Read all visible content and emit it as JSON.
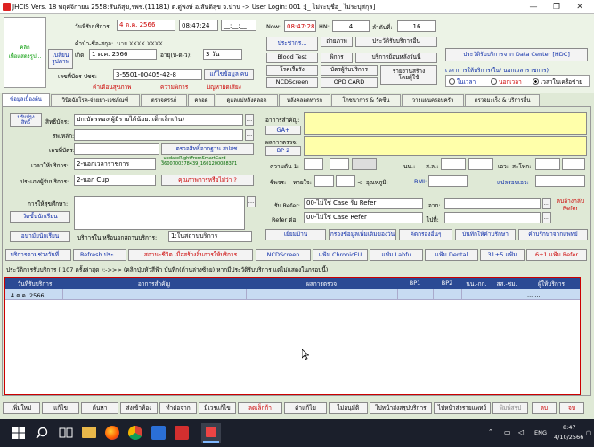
{
  "window": {
    "title": "JHCIS Vers. 18 พฤศจิกายน 2558:สันติสุข,รพช.(11181) ต.ดู่พงษ์ อ.สันติสุข จ.น่าน -> User Login: 001 :[_ ไม่ระบุชื่อ_ ไม่ระบุสกุล]",
    "minimize": "—",
    "maximize": "❐",
    "close": "✕"
  },
  "header": {
    "click_label": "คลิก\nเพื่อแสดงรูป...",
    "change_photo": "เปลี่ยน\nรูปภาพ",
    "visit_date_label": "วันที่รับบริการ",
    "visit_date": "4 ต.ค. 2566",
    "visit_time": "08:47:24",
    "time_blank": "__:__:__",
    "now_label": "Now:",
    "now_time": "08:47:28",
    "hn_label": "HN:",
    "hn_value": "4",
    "queue_label": "ลำดับที่:",
    "queue_value": "16",
    "name_label": "คำนำ-ชื่อ-สกุล:",
    "name_value": "นาย XXXX XXXX",
    "birth_label": "เกิด:",
    "birth_value": "1 ต.ค. 2566",
    "age_label": "อายุ(ป-ด-ว):",
    "age_value": "3 วัน",
    "cid_label": "เลขที่บัตร ปชช:",
    "cid_value": "3-5501-00405-42-8",
    "edit_person": "แก้ไขข้อมูล คน",
    "warn1": "คำเตือนสุขภาพ",
    "warn2": "ความพิการ",
    "warn3": "ปัญหาผิดเสียง",
    "btn_pracha": "ประชากร...",
    "btn_takeshot": "ถ่ายภาพ",
    "btn_history": "ประวัติรับบริการอื่น",
    "btn_blood": "Blood Test",
    "btn_disabled": "พิการ",
    "btn_service_after": "บริการย้อนหลังวันนี้",
    "btn_chronic": "โรคเรื้อรัง",
    "btn_card": "บัตรผู้รับบริการ",
    "btn_report": "รายงานสร้าง\nโดยผู้ใช้",
    "btn_ncd": "NCDScreen",
    "btn_opd": "OPD CARD",
    "btn_history_hdc": "ประวัติรับบริการจาก Data Center [HDC]",
    "time_group_label": "เวลาการให้บริการ(ใน/ นอกเวลาราชการ)",
    "radio_in": "ในเวลา",
    "radio_out": "นอกเวลา",
    "radio_outside": "เวลาในเครือข่าย"
  },
  "tabs": [
    "ข้อมูลเบื้องต้น",
    "วินิจฉัยโรค-จ่ายยา-เวชภัณฑ์",
    "ตรวจครรภ์",
    "คลอด",
    "ดูแลแม่หลังคลอด",
    "หลังคลอดทารก",
    "โภชนาการ & วัคซีน",
    "วางแผนครอบครัว",
    "ตรวจมะเร็ง & บริการอื่น"
  ],
  "form": {
    "payer_btn": "ปรับปรุง\nสิทธิ์",
    "right_label": "สิทธิ์บัตร:",
    "right_value": "ปก:บัตรทอง(ผู้มีรายได้น้อย..เด็กเล็กเกิน)",
    "hosp_label": "รพ.หลัก:",
    "sub_label": "เลขที่บัตร:",
    "check_right": "ตรวจสิทธิ์จากฐาน สปสช.",
    "update_smart": "_updateRightFromSmartCard\n3600700378439_1601200088371",
    "quality_btn": "คุณภาพการหรือไม่ว่า ?",
    "svc_time_label": "เวลาให้บริการ:",
    "svc_time_value": "2-นอกเวลาราชการ",
    "svc_type_label": "ประเภทผู้รับบริการ:",
    "svc_type_value": "2-นอก Cup",
    "complaint_label": "อาการสำคัญ:",
    "ga_btn": "GA+",
    "exam_label": "ผลการตรวจ:",
    "bp2_btn": "BP 2",
    "bp_label": "ความดัน 1:",
    "weight_label": "นน.:",
    "height_label": "ส.ล.:",
    "waist_label": "เอว:",
    "chest_label": "สะโพก:",
    "pulse_label": "ชีพจร:",
    "resp_label": "หายใจ:",
    "temp_label": "<- อุณหภูมิ:",
    "bmi_label": "BMI:",
    "spo_label": "แปลรอบเอว:",
    "history_label": "การให้สุขศึกษา:",
    "diag_btn": "วัดขั้นนักเรียน",
    "school_btn": "อนามัยนักเรียน",
    "service_place_label": "บริการใน หรือนอกสถานบริการ:",
    "service_place_value": "1:ในสถานบริการ",
    "refer_in_label": "รับ Refer:",
    "refer_in_value": "00-ไม่ใช่ Case รับ Refer",
    "refer_out_label": "Refer ต่อ:",
    "refer_out_value": "00-ไม่ใช่ Case Refer",
    "from_label": "จาก:",
    "to_label": "ไปที่:",
    "refer_note": "ลบล้างกลับ\nRefer",
    "btns_row": [
      "เยี่ยมบ้าน",
      "กรองข้อมูลเพิ่มเติมของวัน",
      "คัดกรองอื่นๆ",
      "บันทึกให้คำปรึกษา",
      "คำปรึกษาจากแพทย์"
    ],
    "tabs2": [
      "บริการตามช่วงวันที่ ...",
      "Refresh ประ...",
      "สถานะชีวิต เมื่อสร้างสิ้นการให้บริการ",
      "NCDScreen",
      "แฟ้ม ChronicFU",
      "แฟ้ม Labfu",
      "แฟ้ม Dental",
      "31+5 แฟ้ม",
      "6+1 แฟ้ม Refer"
    ],
    "history_caption": "ประวัติการรับบริการ ( 107 ครั้งล่าสุด ):->>> (คลิกปุ่มหัวสีฟ้า บันทึก(ด้านล่างซ้าย) หากมีประวัติรับบริการ แต่ไม่แสดงในกรอบนี้)"
  },
  "table": {
    "headers": [
      "วันที่รับบริการ",
      "อาการสำคัญ",
      "ผลการตรวจ",
      "BP1",
      "BP2",
      "นน.-กก.",
      "สส.-ซม.",
      "ผู้ให้บริการ"
    ],
    "rows": [
      {
        "date": "4 ต.ค. 2566",
        "complaint": "",
        "exam": "",
        "bp1": "",
        "bp2": "",
        "weight": "",
        "height": "",
        "provider": "... ..."
      }
    ]
  },
  "bottom": {
    "buttons": [
      "เพิ่มใหม่",
      "แก้ไข",
      "ค้นหา",
      "ส่งเข้าห้อง",
      "ทำต่อจาก",
      "มีเวรแก้ไข",
      "ลดเล็กก้า",
      "ค่าแก้ไข",
      "ไม่อนุมัติ",
      "ไปหน้าส่งสรุปบริการ",
      "ไปหน้าส่งรายแพทย์",
      "พิมพ์สรุป",
      "ลบ",
      "จบ"
    ]
  },
  "taskbar": {
    "lang": "ENG",
    "time": "8:47",
    "date": "4/10/2566"
  }
}
